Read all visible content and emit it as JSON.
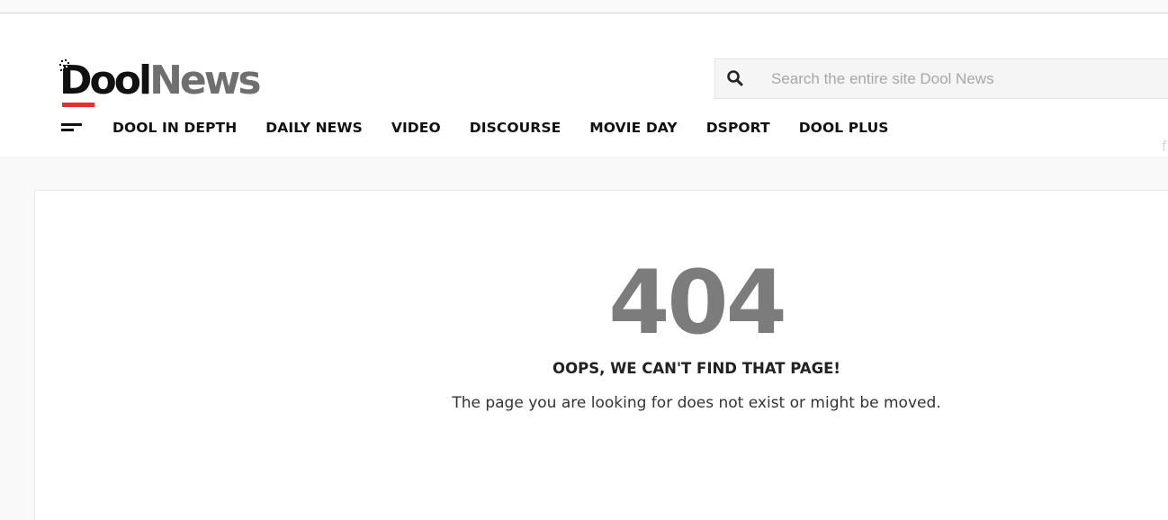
{
  "logo": {
    "word_primary": "Dool",
    "word_secondary": "News"
  },
  "search": {
    "icon": "search-icon",
    "placeholder": "Search the entire site Dool News",
    "value": ""
  },
  "nav": {
    "menu_icon": "hamburger-menu-icon",
    "items": [
      {
        "label": "DOOL IN DEPTH"
      },
      {
        "label": "DAILY NEWS"
      },
      {
        "label": "VIDEO"
      },
      {
        "label": "DISCOURSE"
      },
      {
        "label": "MOVIE DAY"
      },
      {
        "label": "DSPORT"
      },
      {
        "label": "DOOL PLUS"
      }
    ]
  },
  "error": {
    "code": "404",
    "title": "OOPS, WE CAN'T FIND THAT PAGE!",
    "message": "The page you are looking for does not exist or might be moved."
  },
  "colors": {
    "accent_red": "#e0312b",
    "logo_dark": "#111111",
    "logo_grey": "#6f6f6f",
    "error_code_grey": "#7c7c7c"
  }
}
